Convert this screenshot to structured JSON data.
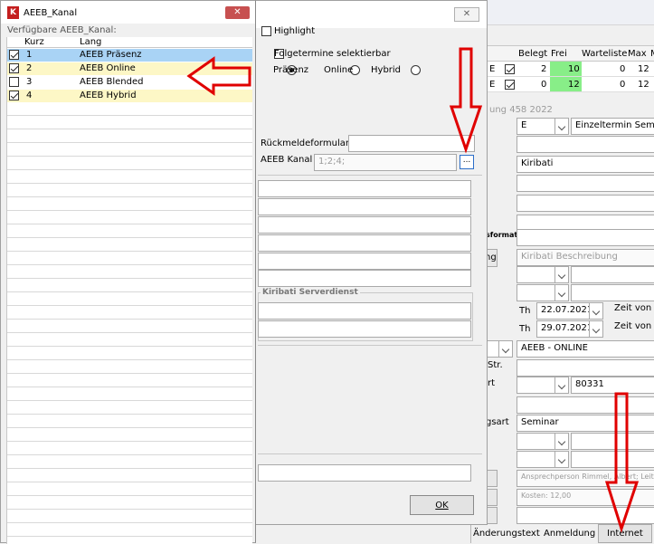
{
  "kanal_window": {
    "title": "AEEB_Kanal",
    "subtitle": "Verfügbare AEEB_Kanal:",
    "col_kurz": "Kurz",
    "col_lang": "Lang",
    "rows": [
      {
        "kurz": "1",
        "lang": "AEEB Präsenz",
        "checked": true
      },
      {
        "kurz": "2",
        "lang": "AEEB Online",
        "checked": true
      },
      {
        "kurz": "3",
        "lang": "AEEB Blended",
        "checked": false
      },
      {
        "kurz": "4",
        "lang": "AEEB Hybrid",
        "checked": true
      }
    ]
  },
  "middle": {
    "highlight_label": "Highlight",
    "folgetermine_label": "Folgetermine selektierbar",
    "radio_praesenz": "Präsenz",
    "radio_online": "Online",
    "radio_hybrid": "Hybrid",
    "rueckmelde_label": "Rückmeldeformular",
    "kanal_label": "AEEB Kanal",
    "kanal_value": "1;2;4;",
    "browse_label": "...",
    "serverdienst_label": "Kiribati Serverdienst",
    "ok_label": "OK"
  },
  "back": {
    "headers": {
      "belegt": "Belegt",
      "frei": "Frei",
      "warteliste": "Warteliste",
      "max": "Max",
      "m": "M"
    },
    "rows": [
      {
        "e": "E",
        "belegt": "2",
        "frei": "10",
        "warteliste": "0",
        "max": "12",
        "checked": true
      },
      {
        "e": "E",
        "belegt": "0",
        "frei": "12",
        "warteliste": "0",
        "max": "12",
        "checked": true
      }
    ],
    "partial_title": "ung 458 2022",
    "type_code": "E",
    "einzeltermin": "Einzeltermin Semin",
    "kiribati": "Kiribati",
    "sformat": "sformat",
    "ng": "ng",
    "beschreibung": "Kiribati Beschreibung",
    "th1": "Th",
    "date1": "22.07.2021",
    "zeit1": "Zeit von",
    "th2": "Th",
    "date2": "29.07.2021",
    "zeit2": "Zeit von",
    "aeeb_online": "AEEB - ONLINE",
    "str": "Str.",
    "rt": "rt",
    "plz": "80331",
    "gsart": "gsart",
    "seminar": "Seminar",
    "ansprech": "Ansprechperson Rimmel, Albert; Leit",
    "kosten": "Kosten: 12,00",
    "aenderungstext": "Änderungstext",
    "anmeldung": "Anmeldung",
    "internet": "Internet"
  },
  "colors": {
    "selected_row": "#a9d3f5",
    "yellow_row": "#fdf7c6",
    "green_cell": "#88ee88",
    "arrow_red": "#e00000"
  }
}
